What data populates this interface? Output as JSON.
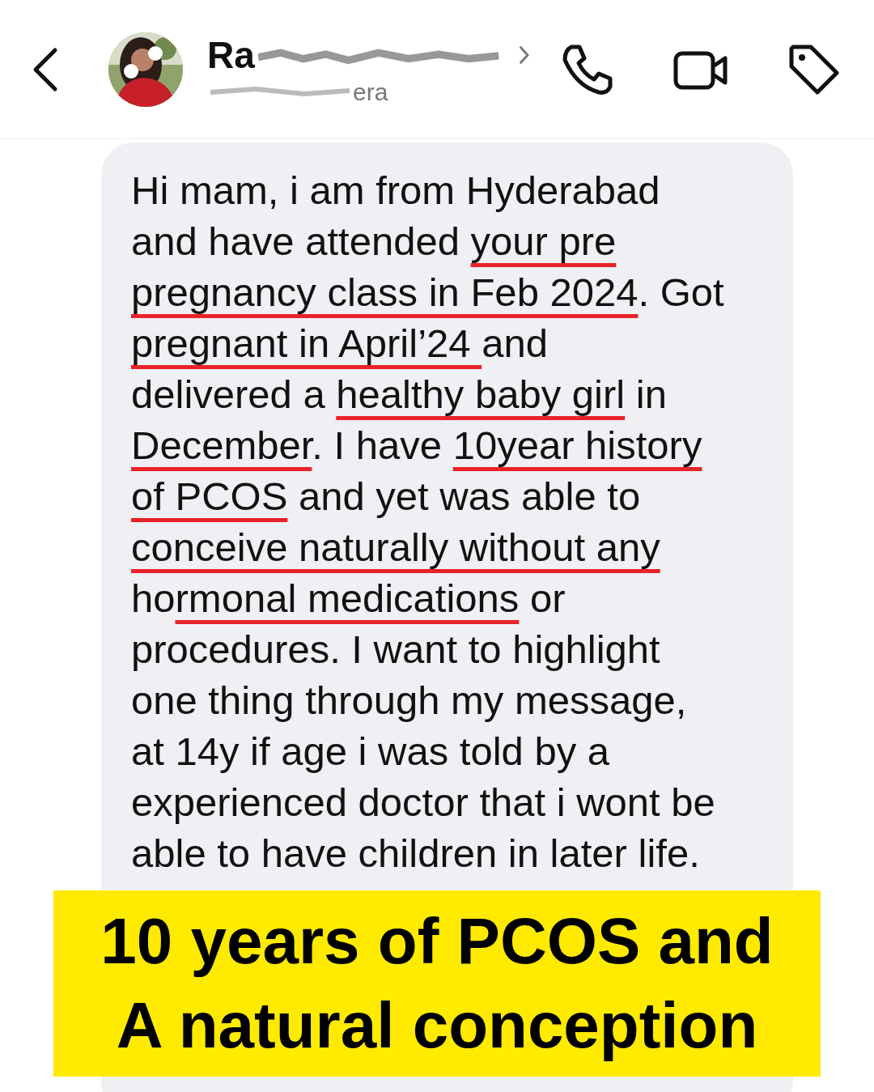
{
  "header": {
    "name": "Ra",
    "username": "era"
  },
  "message": {
    "lines": [
      [
        {
          "text": "Hi mam, i am from Hyderabad",
          "underlined": false
        }
      ],
      [
        {
          "text": "and have attended ",
          "underlined": false
        },
        {
          "text": "your pre",
          "underlined": true
        }
      ],
      [
        {
          "text": "pregnancy class in Feb 2024",
          "underlined": true
        },
        {
          "text": ". Got",
          "underlined": false
        }
      ],
      [
        {
          "text": "pregnant in April’24 ",
          "underlined": true
        },
        {
          "text": "and",
          "underlined": false
        }
      ],
      [
        {
          "text": "delivered a ",
          "underlined": false
        },
        {
          "text": "healthy baby girl",
          "underlined": true
        },
        {
          "text": " in",
          "underlined": false
        }
      ],
      [
        {
          "text": "December",
          "underlined": true
        },
        {
          "text": ". I have ",
          "underlined": false
        },
        {
          "text": "10year history",
          "underlined": true
        }
      ],
      [
        {
          "text": "of PCOS",
          "underlined": true
        },
        {
          "text": " and yet was able to",
          "underlined": false
        }
      ],
      [
        {
          "text": "conceive naturally without any",
          "underlined": true
        }
      ],
      [
        {
          "text": "ho",
          "underlined": false
        },
        {
          "text": "rmonal medications",
          "underlined": true
        },
        {
          "text": " or",
          "underlined": false
        }
      ],
      [
        {
          "text": "procedures. I want to highlight",
          "underlined": false
        }
      ],
      [
        {
          "text": "one thing through my message,",
          "underlined": false
        }
      ],
      [
        {
          "text": "at 14y if age i was told by a",
          "underlined": false
        }
      ],
      [
        {
          "text": "experienced doctor that i wont be",
          "underlined": false
        }
      ],
      [
        {
          "text": "able to have children in later life.",
          "underlined": false
        }
      ]
    ]
  },
  "caption": {
    "lines": [
      "10 years of PCOS and",
      "A natural conception"
    ]
  }
}
